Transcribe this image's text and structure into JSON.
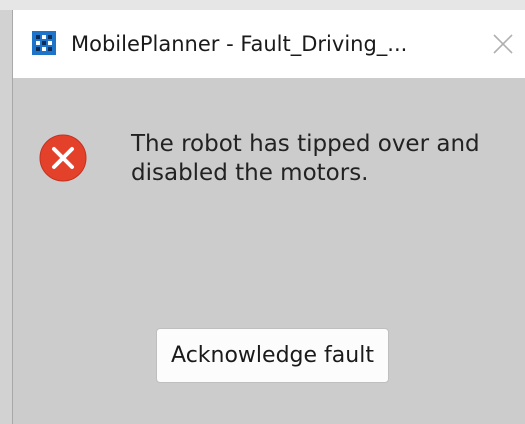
{
  "window": {
    "title": "MobilePlanner - Fault_Driving_...",
    "app_icon": "mobileplanner-app-icon",
    "close_icon": "close-icon"
  },
  "dialog": {
    "icon": "error-icon",
    "icon_color": "#e4412b",
    "message": "The robot has tipped over and disabled the motors.",
    "button_label": "Acknowledge fault"
  }
}
